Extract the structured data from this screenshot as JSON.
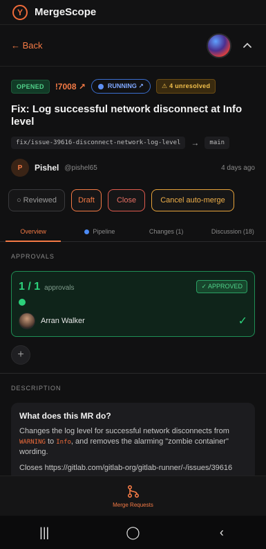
{
  "app": {
    "name": "MergeScope"
  },
  "nav": {
    "back_label": "← Back"
  },
  "mr": {
    "status_opened": "OPENED",
    "id": "!7008 ↗",
    "running": "RUNNING ↗",
    "unresolved": "⚠ 4 unresolved",
    "title": "Fix: Log successful network disconnect at Info level",
    "source_branch": "fix/issue-39616-disconnect-network-log-level",
    "arrow": "→",
    "target_branch": "main",
    "author": {
      "initial": "P",
      "name": "Pishel",
      "handle": "@pishel65",
      "time": "4 days ago"
    }
  },
  "actions": {
    "reviewed": "○ Reviewed",
    "draft": "Draft",
    "close": "Close",
    "cancel_auto_merge": "Cancel auto-merge"
  },
  "tabs": {
    "overview": "Overview",
    "pipeline": "Pipeline",
    "changes": "Changes (1)",
    "discussion": "Discussion (18)"
  },
  "approvals": {
    "section_label": "APPROVALS",
    "count": "1 / 1",
    "label": "approvals",
    "badge": "✓ APPROVED",
    "approver_name": "Arran Walker",
    "check": "✓"
  },
  "add_label": "+",
  "description": {
    "section_label": "DESCRIPTION",
    "title": "What does this MR do?",
    "p1_a": "Changes the log level for successful network disconnects from ",
    "p1_code1": "WARNING",
    "p1_b": " to ",
    "p1_code2": "Info",
    "p1_c": ", and removes the alarming \"zombie container\" wording.",
    "p2": "Closes https://gitlab.com/gitlab-org/gitlab-runner/-/issues/39616"
  },
  "bottom_nav": {
    "label": "Merge Requests"
  },
  "system": {
    "recent": "|||",
    "home": "◯",
    "back": "‹"
  },
  "colors": {
    "accent": "#f47a45",
    "success": "#2cd07b",
    "info": "#5d8ff2",
    "warning": "#f3c04c",
    "danger": "#e05b4e"
  }
}
